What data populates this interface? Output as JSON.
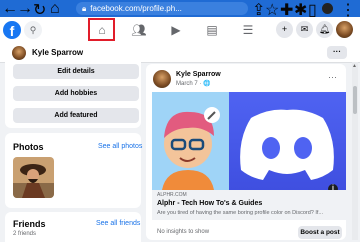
{
  "browser": {
    "url": "facebook.com/profile.ph..."
  },
  "topbar": {
    "logo": "f"
  },
  "profile": {
    "name": "Kyle Sparrow"
  },
  "left_panel": {
    "buttons": [
      "Edit details",
      "Add hobbies",
      "Add featured"
    ],
    "photos": {
      "title": "Photos",
      "link": "See all photos"
    },
    "friends": {
      "title": "Friends",
      "link": "See all friends",
      "count": "2 friends"
    }
  },
  "post": {
    "author": "Kyle Sparrow",
    "meta": "March 7 · 🌐",
    "link": {
      "domain": "ALPHR.COM",
      "title": "Alphr - Tech How To's & Guides",
      "description": "Are you tired of having the same boring profile color on Discord? If..."
    },
    "insights": "No insights to show",
    "boost_label": "Boost a post"
  },
  "colors": {
    "chrome": "#1f6bd4",
    "facebook_blue": "#1877f2",
    "discord_blue": "#4f63f2",
    "highlight_red": "#e11d2a"
  }
}
